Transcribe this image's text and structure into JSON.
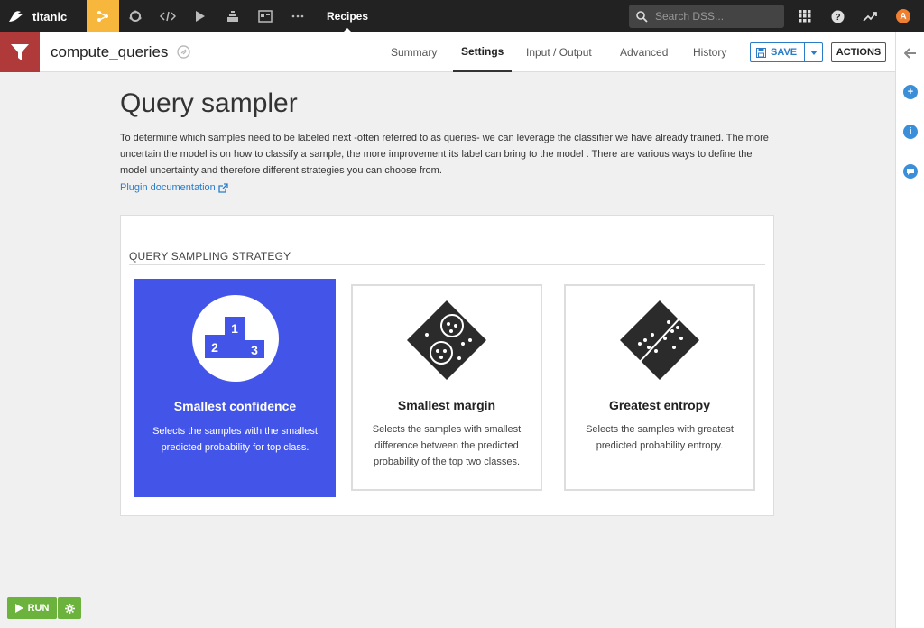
{
  "topnav": {
    "project": "titanic",
    "section": "Recipes",
    "search_placeholder": "Search DSS...",
    "user_initial": "A",
    "accent": "#f6b73c",
    "icons": [
      "flow-icon",
      "jobs-icon",
      "code-icon",
      "run-icon",
      "deploy-icon",
      "dashboard-icon",
      "more-icon"
    ]
  },
  "recipe": {
    "name": "compute_queries",
    "tabs": [
      "Summary",
      "Settings",
      "Input / Output",
      "Advanced",
      "History"
    ],
    "active_tab": "Settings",
    "save_label": "SAVE",
    "actions_label": "ACTIONS"
  },
  "content": {
    "title": "Query sampler",
    "description": "To determine which samples need to be labeled next -often referred to as queries- we can leverage the classifier we have already trained. The more uncertain the model is on how to classify a sample, the more improvement its label can bring to the model . There are various ways to define the model uncertainty and therefore different strategies you can choose from.",
    "doc_link": "Plugin documentation",
    "section_label": "QUERY SAMPLING STRATEGY",
    "strategies": [
      {
        "title": "Smallest confidence",
        "desc": "Selects the samples with the smallest predicted probability for top class.",
        "selected": true,
        "podium": [
          "2",
          "1",
          "3"
        ]
      },
      {
        "title": "Smallest margin",
        "desc": "Selects the samples with smallest difference between the predicted probability of the top two classes.",
        "selected": false
      },
      {
        "title": "Greatest entropy",
        "desc": "Selects the samples with greatest predicted probability entropy.",
        "selected": false
      }
    ]
  },
  "footer": {
    "run_label": "RUN"
  },
  "colors": {
    "selected": "#4355e8",
    "run": "#6bb33c",
    "recipe_type": "#b03a3a",
    "link": "#2a7cc7"
  }
}
